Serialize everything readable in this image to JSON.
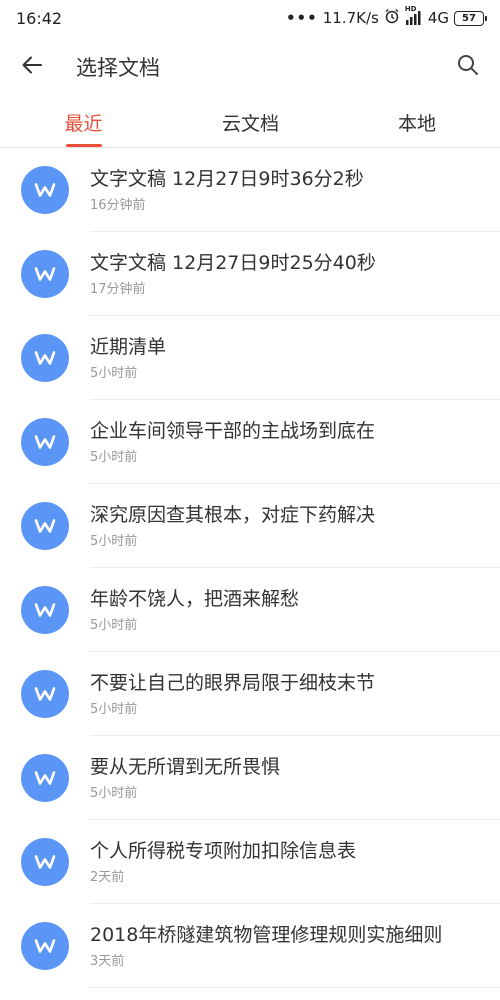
{
  "status_bar": {
    "time": "16:42",
    "dots": "•••",
    "speed": "11.7K/s",
    "signal_label": "HD",
    "network": "4G",
    "battery": "57"
  },
  "header": {
    "title": "选择文档"
  },
  "tabs": [
    {
      "label": "最近",
      "active": true
    },
    {
      "label": "云文档",
      "active": false
    },
    {
      "label": "本地",
      "active": false
    }
  ],
  "documents": [
    {
      "title": "文字文稿 12月27日9时36分2秒",
      "time": "16分钟前"
    },
    {
      "title": "文字文稿 12月27日9时25分40秒",
      "time": "17分钟前"
    },
    {
      "title": "近期清单",
      "time": "5小时前"
    },
    {
      "title": "企业车间领导干部的主战场到底在",
      "time": "5小时前"
    },
    {
      "title": "深究原因查其根本，对症下药解决",
      "time": "5小时前"
    },
    {
      "title": "年龄不饶人，把酒来解愁",
      "time": "5小时前"
    },
    {
      "title": "不要让自己的眼界局限于细枝末节",
      "time": "5小时前"
    },
    {
      "title": "要从无所谓到无所畏惧",
      "time": "5小时前"
    },
    {
      "title": "个人所得税专项附加扣除信息表",
      "time": "2天前"
    },
    {
      "title": "2018年桥隧建筑物管理修理规则实施细则",
      "time": "3天前"
    }
  ],
  "colors": {
    "accent": "#e8503a",
    "doc_icon": "#5b96f7"
  },
  "icons": {
    "back": "arrow-left-icon",
    "search": "search-icon",
    "doc": "word-doc-icon"
  }
}
